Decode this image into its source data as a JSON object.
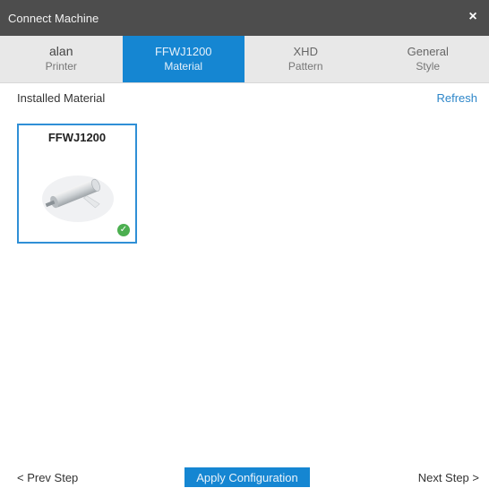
{
  "window": {
    "title": "Connect Machine",
    "close_glyph": "×"
  },
  "tabs": [
    {
      "line1": "alan",
      "line2": "Printer",
      "active": false
    },
    {
      "line1": "FFWJ1200",
      "line2": "Material",
      "active": true
    },
    {
      "line1": "XHD",
      "line2": "Pattern",
      "active": false
    },
    {
      "line1": "General",
      "line2": "Style",
      "active": false
    }
  ],
  "section": {
    "title": "Installed Material",
    "refresh_label": "Refresh"
  },
  "materials": [
    {
      "name": "FFWJ1200",
      "installed_icon": "check-circle-icon"
    }
  ],
  "footer": {
    "prev_label": "< Prev Step",
    "apply_label": "Apply Configuration",
    "next_label": "Next Step >"
  },
  "colors": {
    "accent": "#1586d2",
    "titlebar": "#4d4d4d",
    "tabbar": "#e8e8e8",
    "check": "#4caf50"
  }
}
